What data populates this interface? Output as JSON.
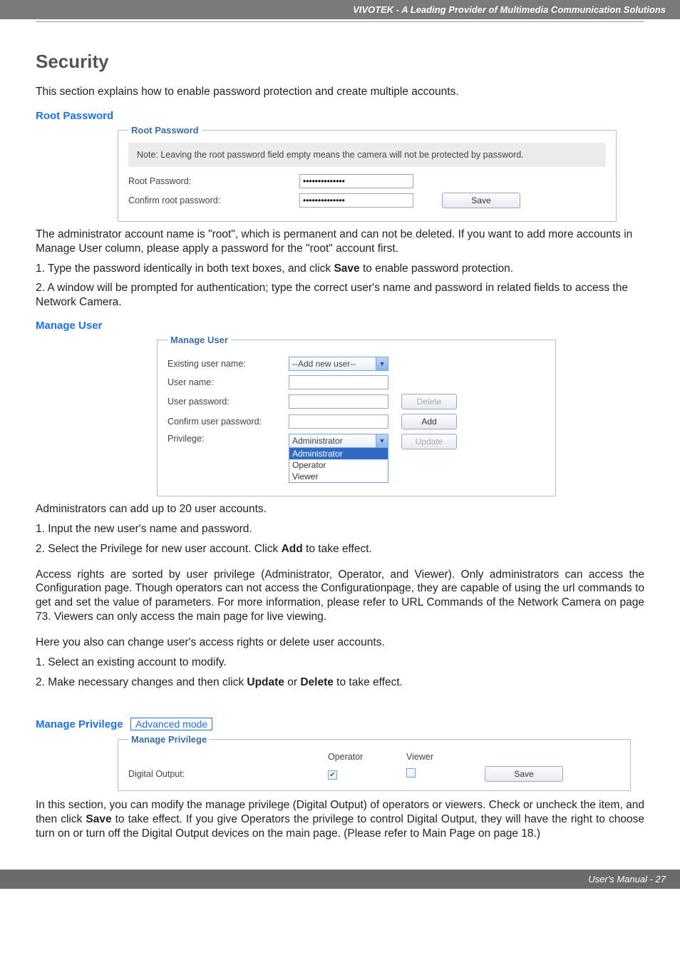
{
  "header": {
    "brand": "VIVOTEK - A Leading Provider of Multimedia Communication Solutions"
  },
  "title": "Security",
  "intro": "This section explains how to enable password protection and create multiple accounts.",
  "root_password": {
    "label": "Root Password",
    "legend": "Root Password",
    "note": "Note: Leaving the root password field empty means the camera will not be protected by password.",
    "row1": "Root Password:",
    "row2": "Confirm root password:",
    "mask": "••••••••••••••",
    "save": "Save"
  },
  "root_password_text": {
    "p1": "The administrator account name is \"root\", which is permanent and can not be deleted. If you want to add more accounts in Manage User column, please apply a password for the \"root\" account first.",
    "l1a": "1. Type the password identically in both text boxes, and click ",
    "l1b": "Save",
    "l1c": " to enable password protection.",
    "l2": "2. A window will be prompted for authentication; type the correct user's name and password in related fields to access the Network Camera."
  },
  "manage_user": {
    "label": "Manage User",
    "legend": "Manage User",
    "existing": "Existing user name:",
    "existing_value": "--Add new user--",
    "username": "User name:",
    "userpw": "User password:",
    "confirmpw": "Confirm user password:",
    "privilege": "Privilege:",
    "privilege_value": "Administrator",
    "dropdown": {
      "a": "Administrator",
      "b": "Operator",
      "c": "Viewer"
    },
    "delete": "Delete",
    "add": "Add",
    "update": "Update"
  },
  "manage_user_text": {
    "l1": "Administrators can add up to 20 user accounts.",
    "l2": "1. Input the new user's name and password.",
    "l3a": "2. Select the Privilege for new user account. Click ",
    "l3b": "Add",
    "l3c": " to take effect.",
    "p2": "Access rights are sorted by user privilege (Administrator, Operator, and Viewer). Only administrators can access the Configuration page. Though operators can not access the Configurationpage, they are capable of using the url commands to get and set the value of parameters. For more information, please refer to URL Commands of the Network Camera on page 73. Viewers can only access the main page for live viewing.",
    "l4": "Here you also can change user's access rights or delete user accounts.",
    "l5": "1. Select an existing account to modify.",
    "l6a": "2. Make necessary changes and then click ",
    "l6b": "Update",
    "l6c": " or ",
    "l6d": "Delete",
    "l6e": " to take effect."
  },
  "manage_privilege": {
    "label": "Manage Privilege",
    "badge": "Advanced mode",
    "legend": "Manage Privilege",
    "col_op": "Operator",
    "col_vw": "Viewer",
    "row": "Digital Output:",
    "save": "Save"
  },
  "manage_privilege_text": {
    "p1a": "In this section, you can modify the manage privilege (Digital Output) of operators or viewers. Check or uncheck the item, and then click ",
    "p1b": "Save",
    "p1c": " to take effect. If you give Operators the privilege to control Digital Output, they will have the right to choose turn on or turn off the Digital Output devices on the main page. (Please refer to Main Page on page 18.)"
  },
  "footer": {
    "text": "User's Manual - 27"
  }
}
